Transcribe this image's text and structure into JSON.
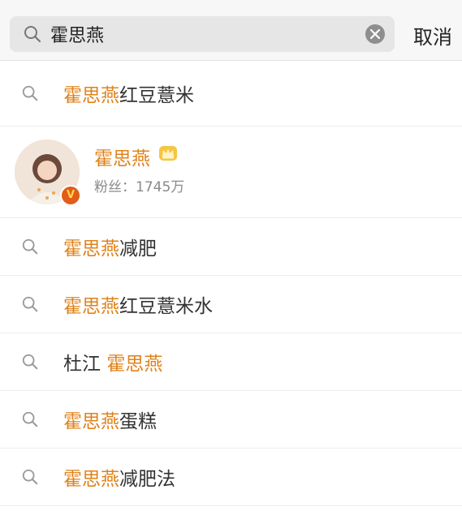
{
  "search": {
    "query": "霍思燕",
    "cancel_label": "取消"
  },
  "suggestions_top": [
    {
      "highlight": "霍思燕",
      "rest": "红豆薏米"
    }
  ],
  "user": {
    "name": "霍思燕",
    "fans_label": "粉丝：",
    "fans_count": "1745万",
    "badge": "V"
  },
  "suggestions": [
    {
      "prefix": "",
      "highlight": "霍思燕",
      "rest": "减肥"
    },
    {
      "prefix": "",
      "highlight": "霍思燕",
      "rest": "红豆薏米水"
    },
    {
      "prefix": "杜江 ",
      "highlight": "霍思燕",
      "rest": ""
    },
    {
      "prefix": "",
      "highlight": "霍思燕",
      "rest": "蛋糕"
    },
    {
      "prefix": "",
      "highlight": "霍思燕",
      "rest": "减肥法"
    }
  ],
  "colors": {
    "highlight": "#e0821a",
    "badge": "#e25c1a"
  },
  "icons": [
    "search-icon",
    "clear-icon",
    "crown-icon",
    "verified-badge-icon"
  ]
}
